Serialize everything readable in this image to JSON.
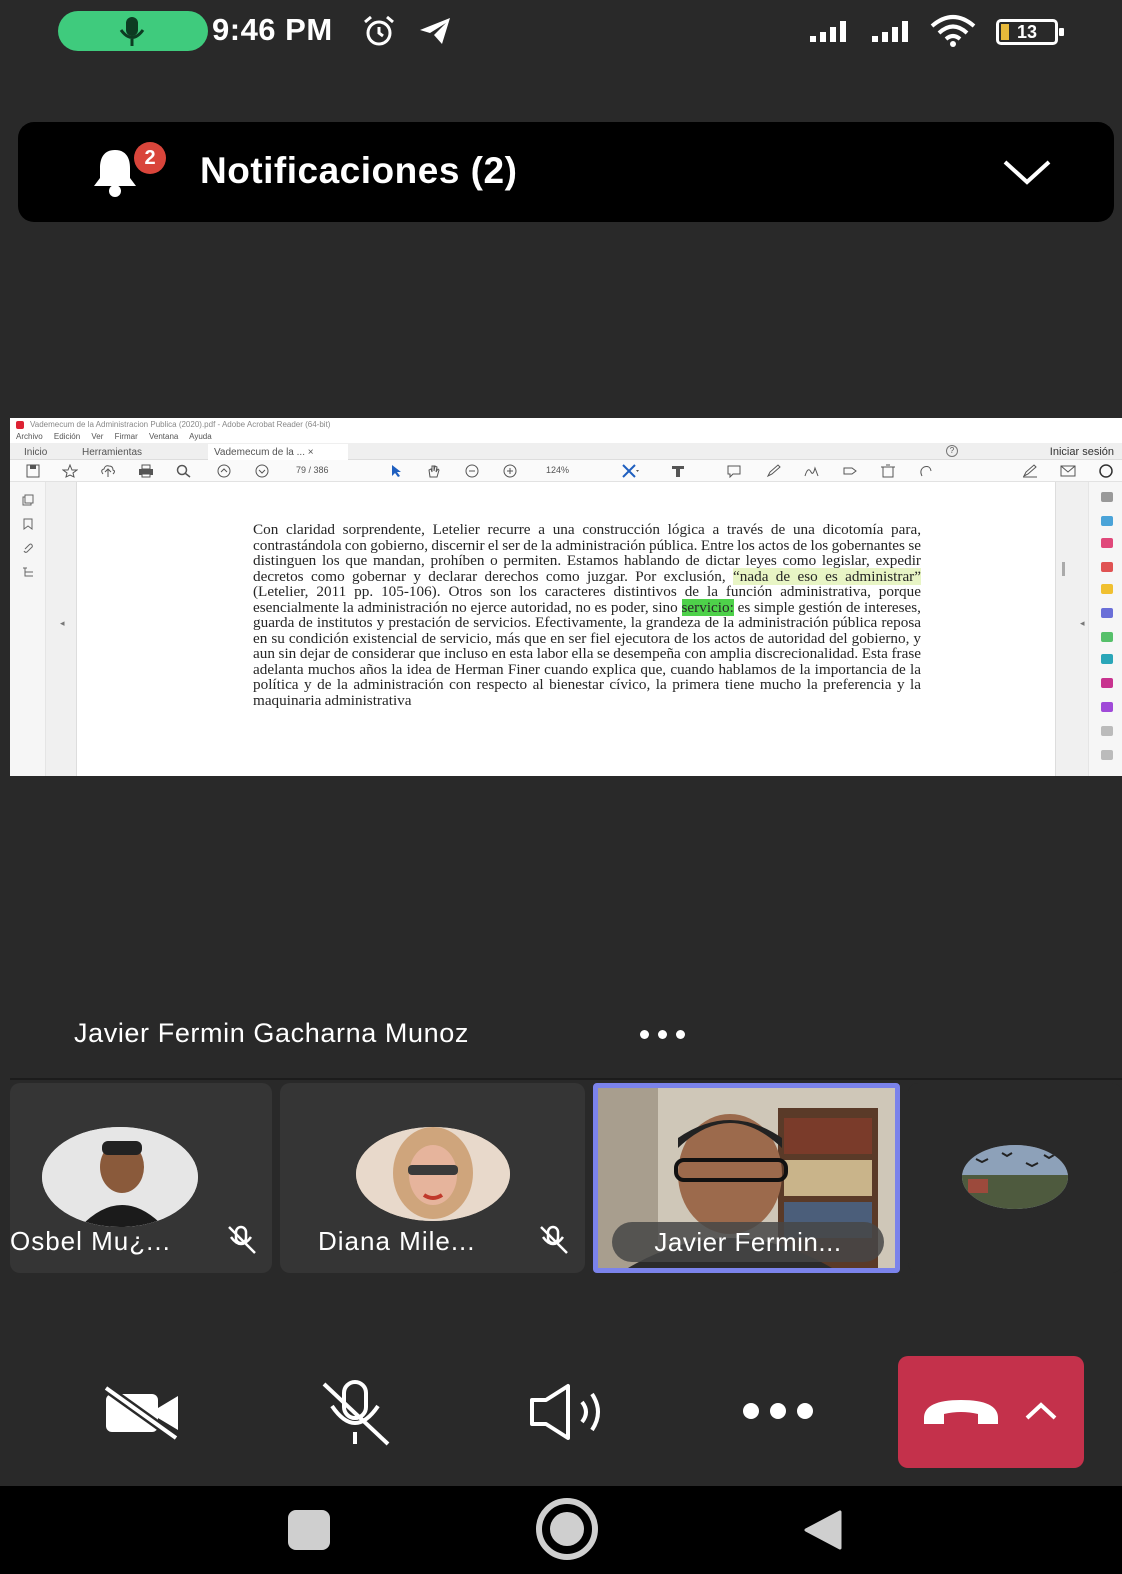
{
  "status_bar": {
    "time": "9:46 PM",
    "battery_level": "13",
    "icons": [
      "mic-icon",
      "alarm-icon",
      "telegram-icon",
      "signal-icon",
      "signal-icon",
      "wifi-icon",
      "battery-icon"
    ]
  },
  "notifications": {
    "title": "Notificaciones (2)",
    "badge_count": "2"
  },
  "shared_document": {
    "app_title": "Vademecum de la Administracion Publica (2020).pdf - Adobe Acrobat Reader (64-bit)",
    "menu": [
      "Archivo",
      "Edición",
      "Ver",
      "Firmar",
      "Ventana",
      "Ayuda"
    ],
    "tabs": {
      "home": "Inicio",
      "tools": "Herramientas",
      "document": "Vademecum de la ...   ×"
    },
    "sign_in": "Iniciar sesión",
    "page_indicator": "79  /  386",
    "zoom": "124%",
    "paragraph": {
      "p1": "Con claridad sorprendente, Letelier recurre a una construcción lógica a través de una dicotomía para, contrastándola con gobierno, discernir el ser de la administración pública. Entre los actos de los gobernantes se distinguen los que mandan, prohíben o permiten. Estamos hablando de dictar leyes como legislar, expedir decretos como gobernar y declarar derechos como juzgar. Por exclusión, ",
      "quote": "“nada de eso es administrar”",
      "p2": " (Letelier, 2011 pp. 105-106). Otros son los caracteres distintivos de la función administrativa, porque esencialmente la administración no ejerce autoridad, no es poder, sino ",
      "highlight": "servicio:",
      "p3": " es simple gestión de intereses, guarda de institutos y prestación de servicios. Efectivamente, la grandeza de la administración pública reposa en su condición existencial de servicio, más que en ser fiel ejecutora de los actos de autoridad del gobierno, y aun sin dejar de considerar que incluso en esta labor ella se desempeña con amplia discrecionalidad. Esta frase adelanta muchos años la idea de Herman Finer cuando explica que, cuando hablamos de la importancia de la política y de la administración con respecto al bienestar cívico, la primera tiene mucho la preferencia y la maquinaria administrativa"
    }
  },
  "speaker": {
    "name": "Javier Fermin Gacharna Munoz"
  },
  "participants": [
    {
      "name": "Osbel  Mu¿...",
      "muted": true
    },
    {
      "name": "Diana Mile...",
      "muted": true
    },
    {
      "name": "Javier Fermin...",
      "muted": false,
      "video": true
    },
    {
      "name": "",
      "muted": false
    }
  ],
  "controls": {
    "icons": [
      "camera-off-icon",
      "mic-off-icon",
      "speaker-icon",
      "more-icon",
      "hang-up-icon",
      "chevron-up-icon"
    ]
  },
  "colors": {
    "background": "#292929",
    "hangup": "#c4314b",
    "active_speaker_border": "#7b83eb",
    "mic_pill": "#3fcb7d",
    "notification_badge": "#d9453b"
  }
}
